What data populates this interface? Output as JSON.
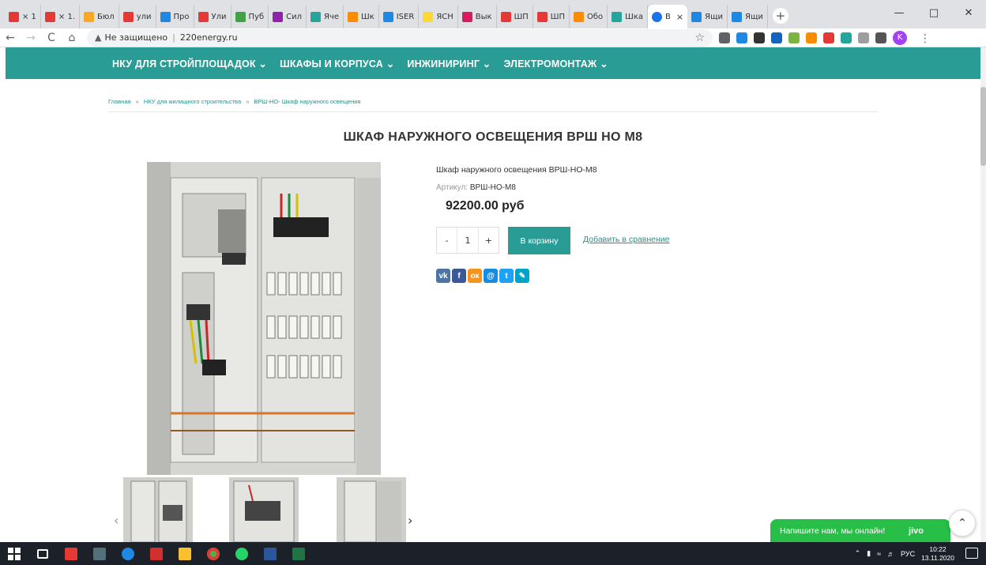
{
  "browser": {
    "tabs": [
      {
        "label": "× 1",
        "color": "#e53935"
      },
      {
        "label": "× 1.",
        "color": "#e53935"
      },
      {
        "label": "Бюл",
        "color": "#f9a825"
      },
      {
        "label": "ули",
        "color": "#e53935"
      },
      {
        "label": "Про",
        "color": "#1e88e5"
      },
      {
        "label": "Ули",
        "color": "#e53935"
      },
      {
        "label": "Пуб",
        "color": "#43a047"
      },
      {
        "label": "Сил",
        "color": "#8e24aa"
      },
      {
        "label": "Яче",
        "color": "#26a69a"
      },
      {
        "label": "Шк",
        "color": "#fb8c00"
      },
      {
        "label": "ISER",
        "color": "#1e88e5"
      },
      {
        "label": "ЯСН",
        "color": "#fdd835"
      },
      {
        "label": "Вык",
        "color": "#d81b60"
      },
      {
        "label": "ШП",
        "color": "#e53935"
      },
      {
        "label": "ШП",
        "color": "#e53935"
      },
      {
        "label": "Обо",
        "color": "#fb8c00"
      },
      {
        "label": "Шка",
        "color": "#26a69a"
      }
    ],
    "active_tab": {
      "label": "В",
      "close": "×"
    },
    "after_tabs": [
      {
        "label": "Ящи",
        "color": "#1e88e5"
      },
      {
        "label": "Ящи",
        "color": "#1e88e5"
      }
    ],
    "new_tab": "+",
    "window_controls": {
      "minimize": "—",
      "maximize": "□",
      "close": "✕"
    },
    "nav": {
      "back": "←",
      "forward": "→",
      "reload": "C",
      "home": "⌂"
    },
    "security_label": "Не защищено",
    "url": "220energy.ru",
    "bookmark_star": "☆",
    "profile_initial": "K",
    "menu": "⋮"
  },
  "site_nav": {
    "items": [
      "НКУ ДЛЯ СТРОЙПЛОЩАДОК ⌄",
      "ШКАФЫ И КОРПУСА ⌄",
      "ИНЖИНИРИНГ ⌄",
      "ЭЛЕКТРОМОНТАЖ ⌄"
    ]
  },
  "breadcrumb": {
    "items": [
      "Главная",
      "НКУ для жилищного строительства",
      "ВРШ-НО- Шкаф наружного освещения"
    ],
    "separator": "»"
  },
  "product": {
    "title": "ШКАФ НАРУЖНОГО ОСВЕЩЕНИЯ ВРШ НО М8",
    "description": "Шкаф наружного освещения ВРШ-НО-М8",
    "sku_label": "Артикул:",
    "sku_value": "ВРШ-НО-М8",
    "price": "92200.00 руб",
    "qty_minus": "-",
    "qty_value": "1",
    "qty_plus": "+",
    "cart_label": "В корзину",
    "compare_label": "Добавить в сравнение",
    "thumb_prev": "‹",
    "thumb_next": "›"
  },
  "share": [
    {
      "name": "vk",
      "glyph": "vk",
      "color": "#4c75a3"
    },
    {
      "name": "facebook",
      "glyph": "f",
      "color": "#3b5998"
    },
    {
      "name": "odnoklassniki",
      "glyph": "ок",
      "color": "#f7931e"
    },
    {
      "name": "moimir",
      "glyph": "@",
      "color": "#168de2"
    },
    {
      "name": "twitter",
      "glyph": "t",
      "color": "#1da1f2"
    },
    {
      "name": "livejournal",
      "glyph": "✎",
      "color": "#00a2c7"
    }
  ],
  "chat": {
    "text": "Напишите нам, мы онлайн!",
    "brand": "jivo"
  },
  "scroll_top": "⌃",
  "taskbar": {
    "lang": "РУС",
    "time": "10:22",
    "date": "13.11.2020",
    "tray_chevron": "⌃"
  },
  "colors": {
    "accent": "#299c96",
    "link": "#2a8f8a",
    "chat": "#27bf47"
  }
}
